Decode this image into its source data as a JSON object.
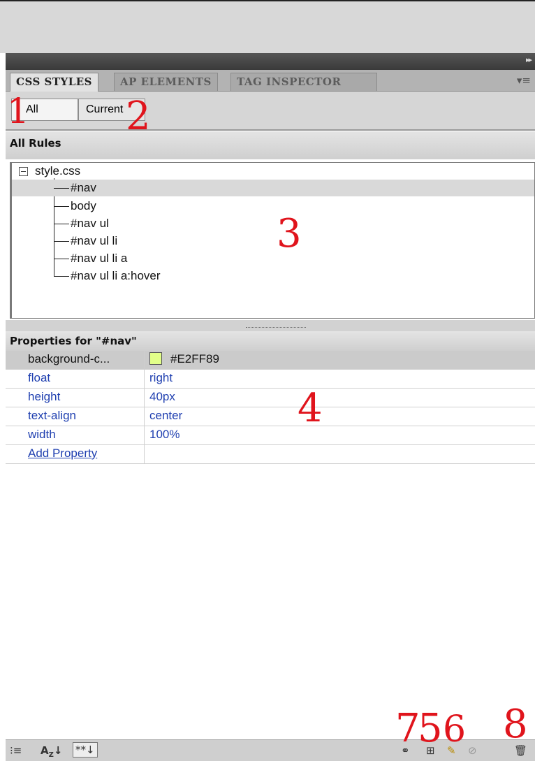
{
  "tabs": [
    {
      "label": "CSS STYLES",
      "active": true
    },
    {
      "label": "AP ELEMENTS",
      "active": false
    },
    {
      "label": "TAG INSPECTOR",
      "active": false
    }
  ],
  "toggle": {
    "all_label": "All",
    "current_label": "Current"
  },
  "rules_section": {
    "title": "All Rules",
    "stylesheet": "style.css",
    "rules": [
      "#nav",
      "body",
      "#nav ul",
      "#nav ul li",
      "#nav ul li a",
      "#nav ul li a:hover"
    ],
    "selected_rule": "#nav"
  },
  "properties_section": {
    "title": "Properties for \"#nav\"",
    "rows": [
      {
        "name": "background-c...",
        "value": "#E2FF89",
        "swatch": "#E2FF89"
      },
      {
        "name": "float",
        "value": "right"
      },
      {
        "name": "height",
        "value": "40px"
      },
      {
        "name": "text-align",
        "value": "center"
      },
      {
        "name": "width",
        "value": "100%"
      }
    ],
    "add_property_label": "Add Property"
  },
  "annotations": [
    "1",
    "2",
    "3",
    "4",
    "7",
    "5",
    "6",
    "8"
  ],
  "icons": {
    "left": [
      "show-category-view-icon",
      "show-alphabetical-view-icon",
      "show-set-properties-icon"
    ],
    "right": [
      "attach-style-sheet-icon",
      "new-css-rule-icon",
      "edit-rule-icon",
      "disable-property-icon",
      "delete-css-rule-icon"
    ]
  },
  "colors": {
    "annotation": "#e0141c",
    "property_text": "#1f3fb0",
    "panel_bg": "#d6d6d6"
  }
}
